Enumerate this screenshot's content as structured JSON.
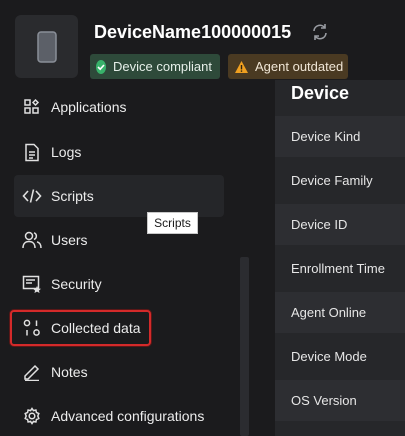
{
  "device": {
    "name": "DeviceName100000015"
  },
  "badges": {
    "compliant": "Device compliant",
    "outdated": "Agent outdated"
  },
  "sidebar": {
    "items": [
      {
        "label": "Applications",
        "icon": "applications-icon"
      },
      {
        "label": "Logs",
        "icon": "document-icon"
      },
      {
        "label": "Scripts",
        "icon": "code-icon"
      },
      {
        "label": "Users",
        "icon": "users-icon"
      },
      {
        "label": "Security",
        "icon": "security-icon"
      },
      {
        "label": "Collected data",
        "icon": "collected-data-icon"
      },
      {
        "label": "Notes",
        "icon": "pencil-icon"
      },
      {
        "label": "Advanced configurations",
        "icon": "gear-icon"
      }
    ]
  },
  "tooltip": "Scripts",
  "panel": {
    "heading": "Device",
    "rows": [
      "Device Kind",
      "Device Family",
      "Device ID",
      "Enrollment Time",
      "Agent Online",
      "Device Mode",
      "OS Version"
    ]
  },
  "colors": {
    "background": "#1b1b1d",
    "panel": "#26272a",
    "highlight": "#d42a2a",
    "compliant_badge": "#2e4a3a",
    "outdated_badge": "#4a3a22",
    "warning": "#f0a020",
    "success": "#38b26a"
  }
}
